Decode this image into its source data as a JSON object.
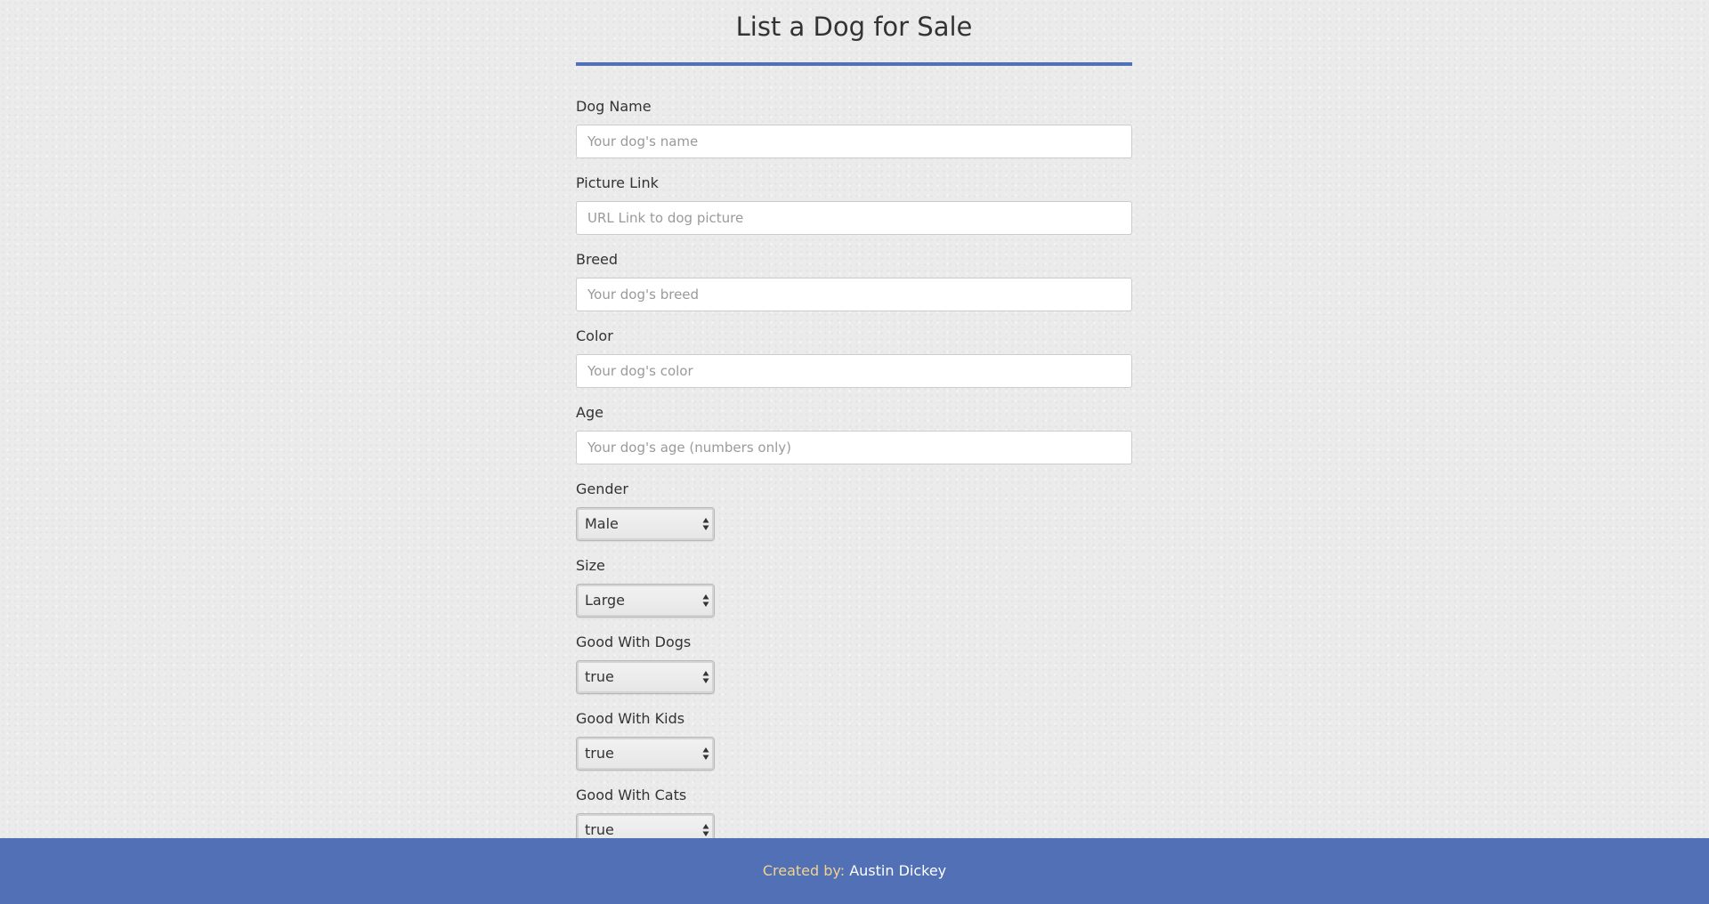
{
  "page": {
    "title": "List a Dog for Sale"
  },
  "form": {
    "text_fields": [
      {
        "label": "Dog Name",
        "placeholder": "Your dog's name",
        "value": ""
      },
      {
        "label": "Picture Link",
        "placeholder": "URL Link to dog picture",
        "value": ""
      },
      {
        "label": "Breed",
        "placeholder": "Your dog's breed",
        "value": ""
      },
      {
        "label": "Color",
        "placeholder": "Your dog's color",
        "value": ""
      },
      {
        "label": "Age",
        "placeholder": "Your dog's age (numbers only)",
        "value": ""
      }
    ],
    "select_fields": [
      {
        "label": "Gender",
        "selected": "Male"
      },
      {
        "label": "Size",
        "selected": "Large"
      },
      {
        "label": "Good With Dogs",
        "selected": "true"
      },
      {
        "label": "Good With Kids",
        "selected": "true"
      },
      {
        "label": "Good With Cats",
        "selected": "true"
      }
    ],
    "select_icon": "select-arrows-icon"
  },
  "footer": {
    "prefix": "Created by:",
    "author": "Austin Dickey"
  },
  "colors": {
    "accent": "#5170b5",
    "background": "#ebebeb",
    "footer_prefix": "#f3d38c",
    "footer_author": "#ffffff"
  }
}
